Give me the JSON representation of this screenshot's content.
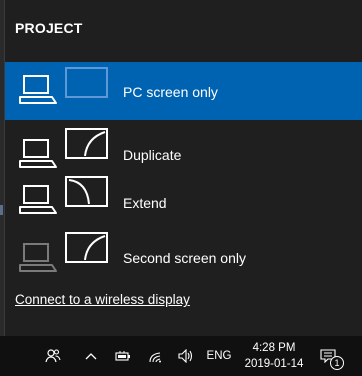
{
  "panel": {
    "title": "PROJECT",
    "options": [
      {
        "label": "PC screen only",
        "selected": true
      },
      {
        "label": "Duplicate",
        "selected": false
      },
      {
        "label": "Extend",
        "selected": false
      },
      {
        "label": "Second screen only",
        "selected": false
      }
    ],
    "wireless_link": "Connect to a wireless display"
  },
  "taskbar": {
    "language": "ENG",
    "time": "4:28 PM",
    "date": "2019-01-14",
    "notification_count": "1",
    "icons": [
      "people-icon",
      "chevron-up-icon",
      "battery-icon",
      "wifi-icon",
      "volume-icon",
      "action-center-icon"
    ]
  },
  "colors": {
    "selected_bg": "#0063b1",
    "panel_bg": "#1f1f1f",
    "taskbar_bg": "#101010"
  }
}
